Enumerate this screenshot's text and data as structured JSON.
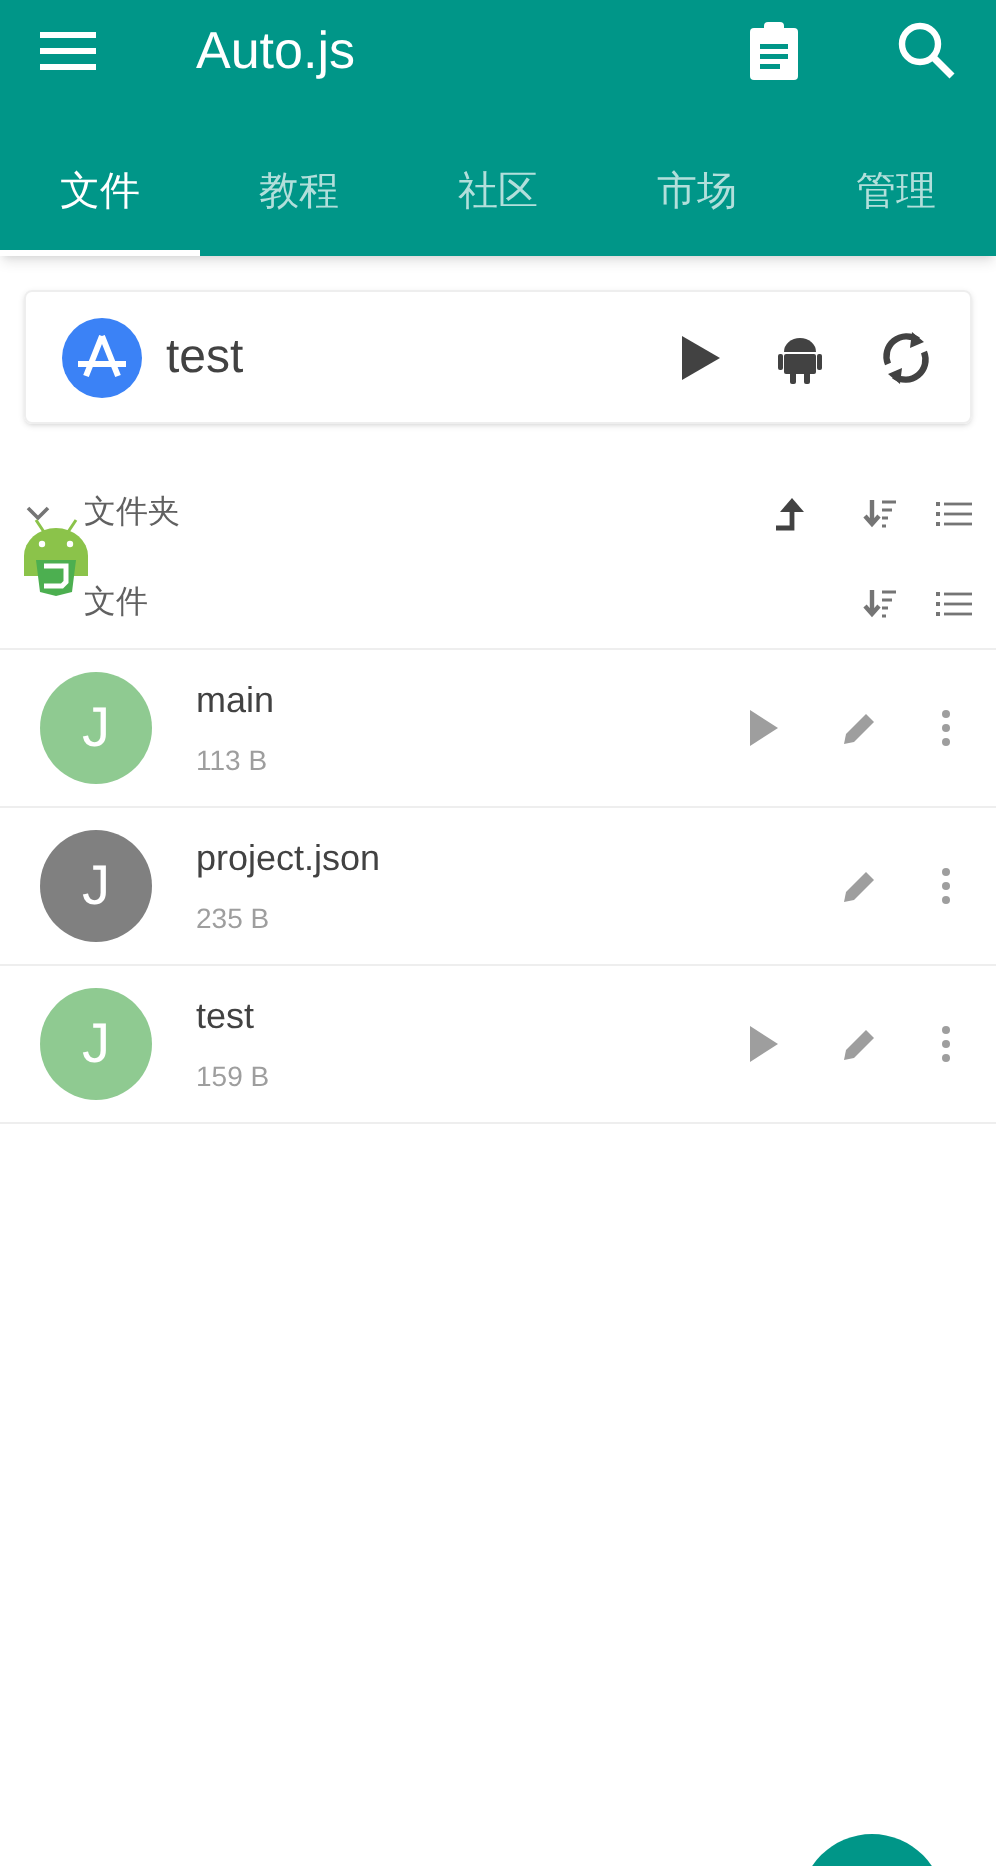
{
  "app_bar": {
    "title": "Auto.js"
  },
  "tabs": [
    {
      "label": "文件",
      "selected": true
    },
    {
      "label": "教程",
      "selected": false
    },
    {
      "label": "社区",
      "selected": false
    },
    {
      "label": "市场",
      "selected": false
    },
    {
      "label": "管理",
      "selected": false
    }
  ],
  "project_card": {
    "name": "test"
  },
  "sections": [
    {
      "label": "文件夹",
      "expanded": true
    },
    {
      "label": "文件"
    }
  ],
  "files": [
    {
      "kind": "script",
      "avatar": "J",
      "name": "main",
      "size": "113 B"
    },
    {
      "kind": "json",
      "avatar": "J",
      "name": "project.json",
      "size": "235 B"
    },
    {
      "kind": "script",
      "avatar": "J",
      "name": "test",
      "size": "159 B"
    }
  ]
}
